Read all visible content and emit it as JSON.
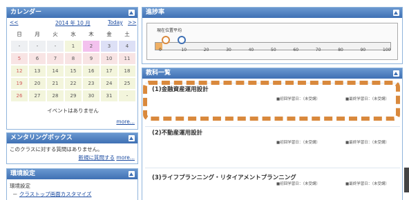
{
  "calendar": {
    "title": "カレンダー",
    "prev": "<<",
    "month": "2014 年 10 月",
    "today": "Today",
    "next": ">>",
    "weekdays": [
      "日",
      "月",
      "火",
      "水",
      "木",
      "金",
      "土"
    ],
    "weeks": [
      [
        "-",
        "-",
        "-",
        "1",
        "2",
        "3",
        "4"
      ],
      [
        "5",
        "6",
        "7",
        "8",
        "9",
        "10",
        "11"
      ],
      [
        "12",
        "13",
        "14",
        "15",
        "16",
        "17",
        "18"
      ],
      [
        "19",
        "20",
        "21",
        "22",
        "23",
        "24",
        "25"
      ],
      [
        "26",
        "27",
        "28",
        "29",
        "30",
        "31",
        "-"
      ]
    ],
    "no_events": "イベントはありません",
    "more": "more..."
  },
  "mentoring": {
    "title": "メンタリングボックス",
    "message": "このクラスに対する質問はありません。",
    "new_question": "新規に質問する",
    "more": "more..."
  },
  "settings": {
    "title": "環境設定",
    "label": "環境設定",
    "link": "クラストップ画面カスタマイズ"
  },
  "progress": {
    "title": "進捗率",
    "legend": "現在位置平均",
    "current_percent": 3,
    "average_percent": 7,
    "ticks": [
      "0",
      "10",
      "20",
      "30",
      "40",
      "50",
      "60",
      "70",
      "80",
      "90",
      "100"
    ],
    "colors": {
      "fill": "#f0b064",
      "current_marker": "#d9893d",
      "average_marker": "#3f70b4"
    }
  },
  "courses": {
    "title": "教科一覧",
    "items": [
      {
        "title": "(1)金融資産運用設計",
        "first": "■初回学習日：（未受講）",
        "last": "■最終学習日：（未受講）"
      },
      {
        "title": "(2)不動産運用設計",
        "first": "■初回学習日：（未受講）",
        "last": "■最終学習日：（未受講）"
      },
      {
        "title": "(3)ライフプランニング・リタイアメントプランニング",
        "first": "■初回学習日：（未受講）",
        "last": "■最終学習日：（未受講）"
      }
    ]
  },
  "theme": {
    "header": "#3f70b4",
    "border": "#8fb4dc",
    "highlight": "#d9893d"
  }
}
